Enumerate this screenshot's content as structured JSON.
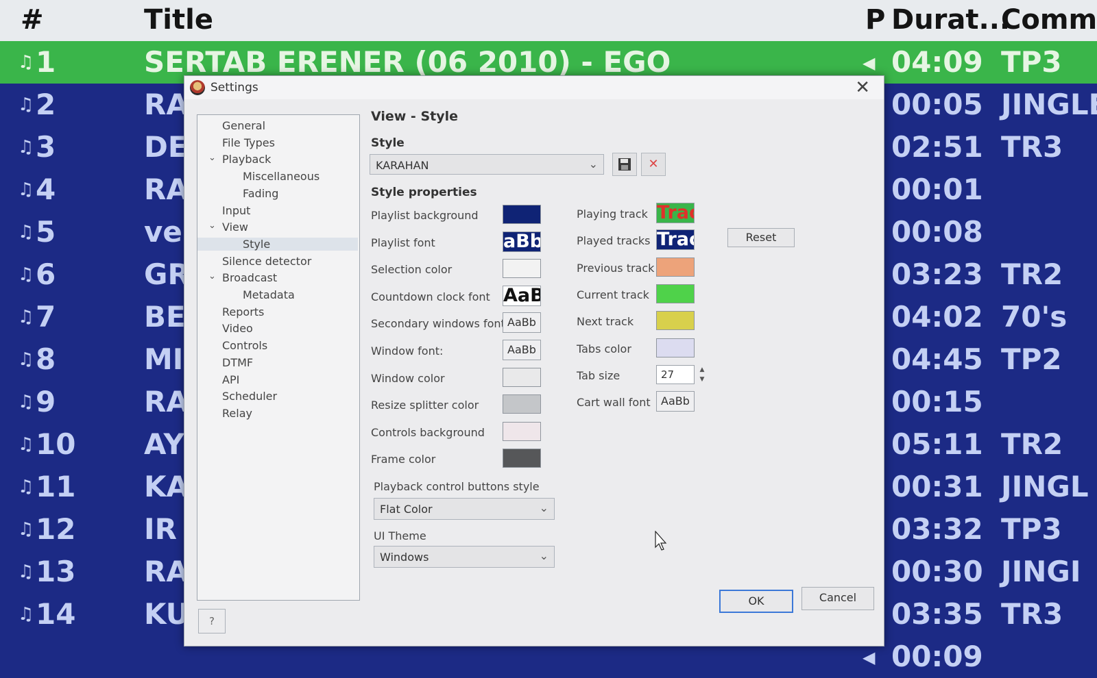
{
  "playlist": {
    "headers": {
      "num": "#",
      "title": "Title",
      "p": "P",
      "duration": "Durat...",
      "comment": "Comme"
    },
    "rows": [
      {
        "num": "1",
        "title": "SERTAB ERENER  (06  2010) - EGO",
        "duration": "04:09",
        "comment": "TP3",
        "playing": true
      },
      {
        "num": "2",
        "title": "RA",
        "duration": "00:05",
        "comment": "JINGLE"
      },
      {
        "num": "3",
        "title": "DE",
        "duration": "02:51",
        "comment": "TR3"
      },
      {
        "num": "4",
        "title": "RA",
        "duration": "00:01",
        "comment": ""
      },
      {
        "num": "5",
        "title": "ve",
        "duration": "00:08",
        "comment": ""
      },
      {
        "num": "6",
        "title": "GR",
        "duration": "03:23",
        "comment": "TR2"
      },
      {
        "num": "7",
        "title": "BE",
        "duration": "04:02",
        "comment": "70's"
      },
      {
        "num": "8",
        "title": "MI",
        "duration": "04:45",
        "comment": "TP2"
      },
      {
        "num": "9",
        "title": "RA",
        "duration": "00:15",
        "comment": ""
      },
      {
        "num": "10",
        "title": "AY",
        "duration": "05:11",
        "comment": "TR2"
      },
      {
        "num": "11",
        "title": "KA",
        "duration": "00:31",
        "comment": "JINGL"
      },
      {
        "num": "12",
        "title": "IR",
        "duration": "03:32",
        "comment": "TP3"
      },
      {
        "num": "13",
        "title": "RA",
        "duration": "00:30",
        "comment": "JINGI"
      },
      {
        "num": "14",
        "title": "KU",
        "duration": "03:35",
        "comment": "TR3"
      },
      {
        "num": "",
        "title": "",
        "duration": "00:09",
        "comment": ""
      }
    ]
  },
  "dialog": {
    "title": "Settings",
    "section_title": "View - Style",
    "style_label": "Style",
    "style_value": "KARAHAN",
    "style_properties_label": "Style properties",
    "tree": [
      {
        "label": "General",
        "level": 0
      },
      {
        "label": "File Types",
        "level": 0
      },
      {
        "label": "Playback",
        "level": 0,
        "expanded": true
      },
      {
        "label": "Miscellaneous",
        "level": 1
      },
      {
        "label": "Fading",
        "level": 1
      },
      {
        "label": "Input",
        "level": 0
      },
      {
        "label": "View",
        "level": 0,
        "expanded": true
      },
      {
        "label": "Style",
        "level": 1,
        "selected": true
      },
      {
        "label": "Silence detector",
        "level": 0
      },
      {
        "label": "Broadcast",
        "level": 0,
        "expanded": true
      },
      {
        "label": "Metadata",
        "level": 1
      },
      {
        "label": "Reports",
        "level": 0
      },
      {
        "label": "Video",
        "level": 0
      },
      {
        "label": "Controls",
        "level": 0
      },
      {
        "label": "DTMF",
        "level": 0
      },
      {
        "label": "API",
        "level": 0
      },
      {
        "label": "Scheduler",
        "level": 0
      },
      {
        "label": "Relay",
        "level": 0
      }
    ],
    "left_props": [
      {
        "label": "Playlist background",
        "kind": "color",
        "color": "#0f2375"
      },
      {
        "label": "Playlist font",
        "kind": "font",
        "sample": "aBb",
        "fg": "#ffffff",
        "bg": "#0f2375",
        "large": true
      },
      {
        "label": "Selection color",
        "kind": "color",
        "color": "#f2f2f2"
      },
      {
        "label": "Countdown clock font",
        "kind": "font",
        "sample": "AaBb",
        "fg": "#111111",
        "bg": "#ffffff",
        "large": true
      },
      {
        "label": "Secondary windows font",
        "kind": "font",
        "sample": "AaBb"
      },
      {
        "label": "Window font:",
        "kind": "font",
        "sample": "AaBb"
      },
      {
        "label": "Window color",
        "kind": "color",
        "color": "#e9e9ea"
      },
      {
        "label": "Resize splitter color",
        "kind": "color",
        "color": "#c4c6c9"
      },
      {
        "label": "Controls background",
        "kind": "color",
        "color": "#efe6ea"
      },
      {
        "label": "Frame color",
        "kind": "color",
        "color": "#565759"
      }
    ],
    "right_props": [
      {
        "label": "Playing track",
        "kind": "font",
        "sample": "Track",
        "fg": "#e0302a",
        "bg": "#3ab54a",
        "large": true
      },
      {
        "label": "Played tracks",
        "kind": "font",
        "sample": "Track",
        "fg": "#ffffff",
        "bg": "#0f2375",
        "large": true
      },
      {
        "label": "Previous track",
        "kind": "color",
        "color": "#eda37a"
      },
      {
        "label": "Current track",
        "kind": "color",
        "color": "#4fd24a"
      },
      {
        "label": "Next track",
        "kind": "color",
        "color": "#d8d04c"
      },
      {
        "label": "Tabs color",
        "kind": "color",
        "color": "#dcdcf0"
      },
      {
        "label": "Tab size",
        "kind": "spin",
        "value": "27"
      },
      {
        "label": "Cart wall font",
        "kind": "font",
        "sample": "AaBb"
      }
    ],
    "reset_label": "Reset",
    "playback_buttons_label": "Playback control buttons style",
    "playback_buttons_value": "Flat Color",
    "ui_theme_label": "UI Theme",
    "ui_theme_value": "Windows",
    "ok_label": "OK",
    "cancel_label": "Cancel",
    "help_label": "?"
  }
}
